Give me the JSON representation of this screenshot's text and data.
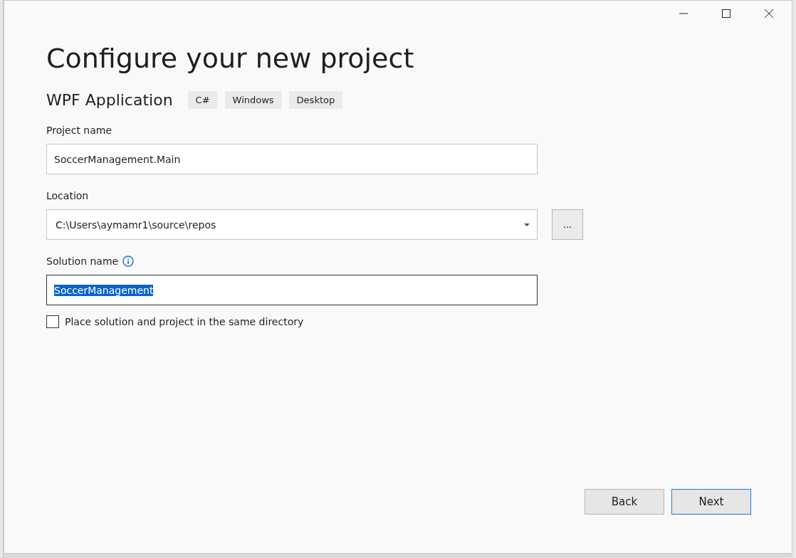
{
  "window": {
    "title": "Configure your new project"
  },
  "template": {
    "name": "WPF Application",
    "tags": [
      "C#",
      "Windows",
      "Desktop"
    ]
  },
  "fields": [
    {
      "kind": "text",
      "label": "Project name",
      "value": "SoccerManagement.Main"
    },
    {
      "kind": "dropdown",
      "label": "Location",
      "value": "C:\\Users\\aymamr1\\source\\repos",
      "browse": "..."
    },
    {
      "kind": "text",
      "label": "Solution name",
      "value": "SoccerManagement",
      "info": true,
      "focused": true,
      "text_selected": true
    }
  ],
  "checkbox": {
    "label": "Place solution and project in the same directory",
    "checked": false
  },
  "buttons": [
    {
      "label": "Back",
      "kind": "secondary"
    },
    {
      "label": "Next",
      "kind": "primary"
    }
  ]
}
